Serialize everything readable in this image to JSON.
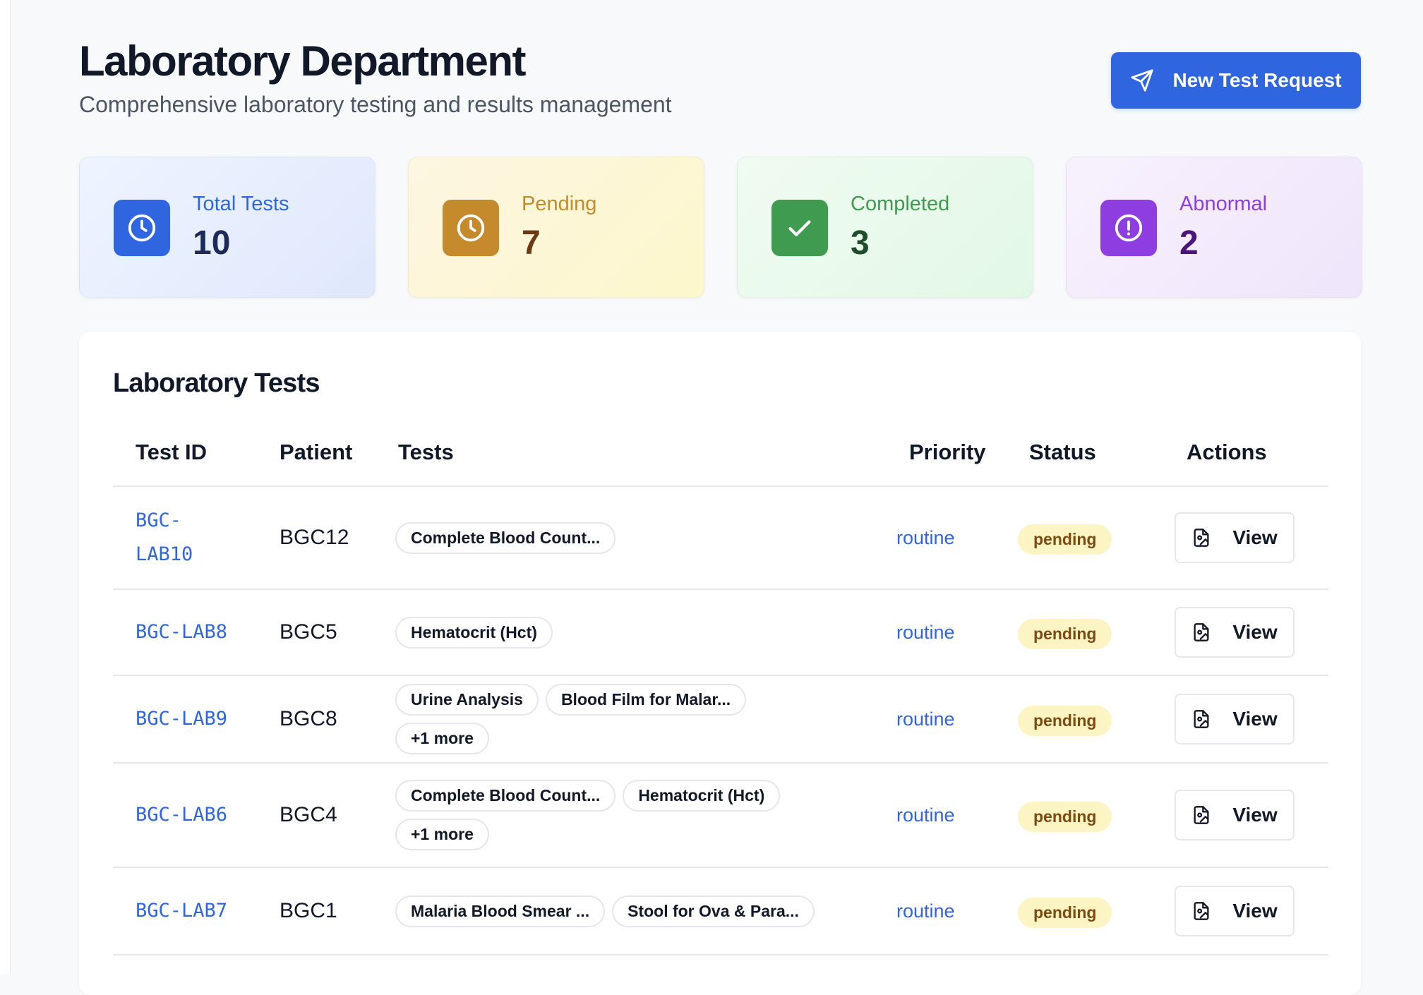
{
  "header": {
    "title": "Laboratory Department",
    "subtitle": "Comprehensive laboratory testing and results management",
    "new_request_label": "New Test Request",
    "new_request_icon": "send-icon"
  },
  "stats": {
    "total": {
      "label": "Total Tests",
      "value": "10",
      "icon": "clock-icon",
      "color": "#2f66e0"
    },
    "pending": {
      "label": "Pending",
      "value": "7",
      "icon": "clock-icon",
      "color": "#c48a2c"
    },
    "completed": {
      "label": "Completed",
      "value": "3",
      "icon": "check-icon",
      "color": "#3e9b4f"
    },
    "abnormal": {
      "label": "Abnormal",
      "value": "2",
      "icon": "alert-circle-icon",
      "color": "#8e3ee0"
    }
  },
  "table": {
    "title": "Laboratory Tests",
    "columns": [
      "Test ID",
      "Patient",
      "Tests",
      "Priority",
      "Status",
      "Actions"
    ],
    "view_label": "View",
    "rows": [
      {
        "id_line1": "BGC-",
        "id_line2": "LAB10",
        "patient": "BGC12",
        "tests": [
          "Complete Blood Count..."
        ],
        "priority": "routine",
        "status": "pending"
      },
      {
        "id": "BGC-LAB8",
        "patient": "BGC5",
        "tests": [
          "Hematocrit (Hct)"
        ],
        "priority": "routine",
        "status": "pending"
      },
      {
        "id": "BGC-LAB9",
        "patient": "BGC8",
        "tests": [
          "Urine Analysis",
          "Blood Film for Malar...",
          "+1 more"
        ],
        "priority": "routine",
        "status": "pending"
      },
      {
        "id": "BGC-LAB6",
        "patient": "BGC4",
        "tests": [
          "Complete Blood Count...",
          "Hematocrit (Hct)",
          "+1 more"
        ],
        "priority": "routine",
        "status": "pending"
      },
      {
        "id": "BGC-LAB7",
        "patient": "BGC1",
        "tests": [
          "Malaria Blood Smear ...",
          "Stool for Ova & Para..."
        ],
        "priority": "routine",
        "status": "pending"
      }
    ]
  },
  "colors": {
    "accent": "#2f66e0",
    "pending_badge_bg": "#fdf4c4",
    "pending_badge_text": "#7c4a12"
  }
}
